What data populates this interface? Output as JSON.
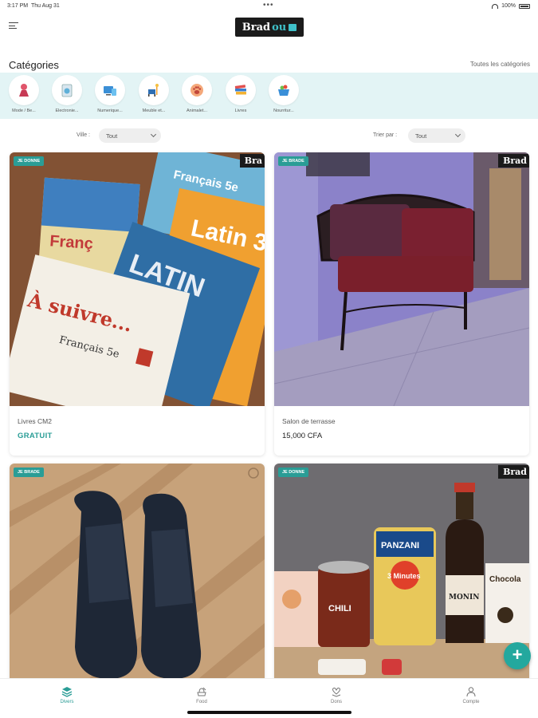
{
  "status_bar": {
    "time": "3:17 PM",
    "date": "Thu Aug 31",
    "battery": "100%"
  },
  "header": {
    "logo_main": "Brad",
    "logo_accent": "ou"
  },
  "categories": {
    "title": "Catégories",
    "see_all": "Toutes les catégories",
    "items": [
      {
        "label": "Mode / Be...",
        "icon": "fashion-icon"
      },
      {
        "label": "Electronie...",
        "icon": "appliance-icon"
      },
      {
        "label": "Numerique...",
        "icon": "devices-icon"
      },
      {
        "label": "Meuble et...",
        "icon": "furniture-icon"
      },
      {
        "label": "Animalet...",
        "icon": "paw-icon"
      },
      {
        "label": "Livres",
        "icon": "books-icon"
      },
      {
        "label": "Nourritur...",
        "icon": "grocery-icon"
      }
    ]
  },
  "filters": {
    "city_label": "Ville :",
    "city_value": "Tout",
    "sort_label": "Trier par :",
    "sort_value": "Tout"
  },
  "listings": [
    {
      "badge": "JE DONNE",
      "brand": "Bra",
      "title": "Livres CM2",
      "price": "GRATUIT",
      "free": true,
      "image_texts": {
        "book1": "Français 5e",
        "book2": "Latin 3",
        "book3": "LATIN",
        "book4": "À suivre...",
        "book4_sub": "Français 5e",
        "book5": "Franç"
      }
    },
    {
      "badge": "JE BRADE",
      "brand": "Brad",
      "title": "Salon de terrasse",
      "price": "15,000 CFA",
      "free": false
    },
    {
      "badge": "JE BRADE",
      "brand": "",
      "title": "",
      "price": "",
      "free": false
    },
    {
      "badge": "JE DONNE",
      "brand": "Brad",
      "title": "",
      "price": "",
      "free": false,
      "image_texts": {
        "pasta_brand": "PANZANI",
        "pasta_sub": "3 Minutes",
        "can": "CHILI",
        "bottle": "MONIN",
        "choco": "Chocola"
      }
    }
  ],
  "bottom_nav": [
    {
      "label": "Divers",
      "icon": "layers-icon",
      "active": true
    },
    {
      "label": "Food",
      "icon": "food-icon",
      "active": false
    },
    {
      "label": "Dons",
      "icon": "gift-heart-icon",
      "active": false
    },
    {
      "label": "Compte",
      "icon": "user-icon",
      "active": false
    }
  ],
  "fab": {
    "label": "+"
  },
  "colors": {
    "accent": "#2a9d96",
    "strip": "#e3f4f5",
    "logo_bg": "#1b1b1b"
  }
}
